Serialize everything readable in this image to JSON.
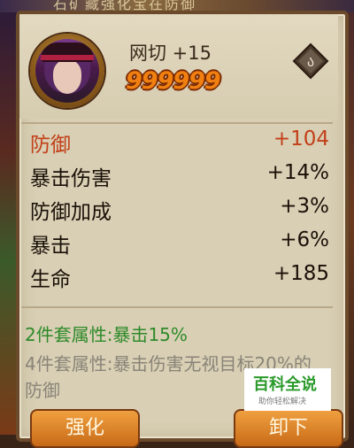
{
  "top_banner_text": "石矿藏强化宝在防御",
  "equipment": {
    "name_level": "网切 +15",
    "power": "999999",
    "lock_icon": "lock-icon"
  },
  "stats": [
    {
      "label": "防御",
      "value": "+104"
    },
    {
      "label": "暴击伤害",
      "value": "+14%"
    },
    {
      "label": "防御加成",
      "value": "+3%"
    },
    {
      "label": "暴击",
      "value": "+6%"
    },
    {
      "label": "生命",
      "value": "+185"
    }
  ],
  "set_bonus": {
    "two_piece": "2件套属性:暴击15%",
    "four_piece": "4件套属性:暴击伤害无视目标20%的防御"
  },
  "buttons": {
    "left": "强化",
    "right": "卸下"
  },
  "watermark": {
    "title": "百科全说",
    "subtitle": "助你轻松解决"
  },
  "colors": {
    "main_stat": "#c2401a",
    "set_active": "#2e8a2a",
    "set_inactive": "#8a8478",
    "power": "#f08010"
  }
}
